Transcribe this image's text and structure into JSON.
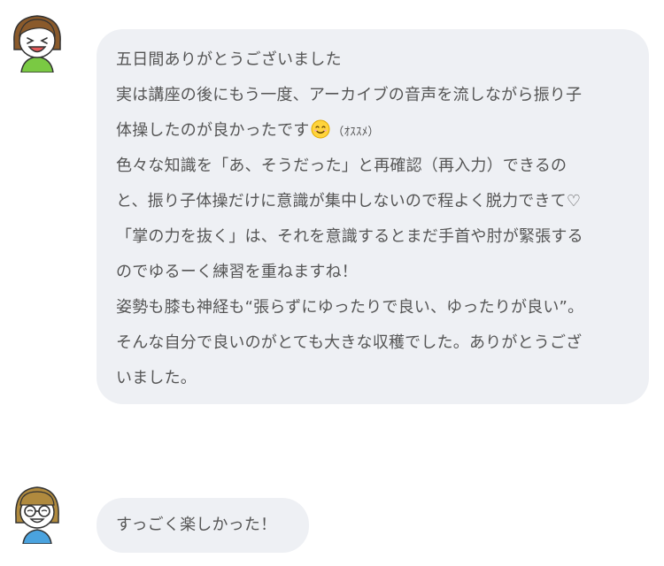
{
  "messages": [
    {
      "lines": [
        "五日間ありがとうございました",
        "実は講座の後にもう一度、アーカイブの音声を流しながら振り子",
        "体操したのが良かったです",
        "色々な知識を「あ、そうだった」と再確認（再入力）できるの",
        "と、振り子体操だけに意識が集中しないので程よく脱力できて♡",
        "「掌の力を抜く」は、それを意識するとまだ手首や肘が緊張する",
        "のでゆるーく練習を重ねますね！",
        "姿勢も膝も神経も“張らずにゆったりで良い、ゆったりが良い”。",
        "そんな自分で良いのがとても大きな収穫でした。ありがとうござ",
        "いました。"
      ],
      "line3_suffix": "（ｵｽｽﾒ）",
      "emoji": "smiling-face-emoji"
    },
    {
      "text": "すっごく楽しかった！"
    }
  ],
  "colors": {
    "bubble_bg": "#eef0f4",
    "text": "#555555",
    "avatar1_shirt": "#7ac943",
    "avatar2_shirt": "#4aa3df",
    "hair": "#8a5a2b"
  }
}
